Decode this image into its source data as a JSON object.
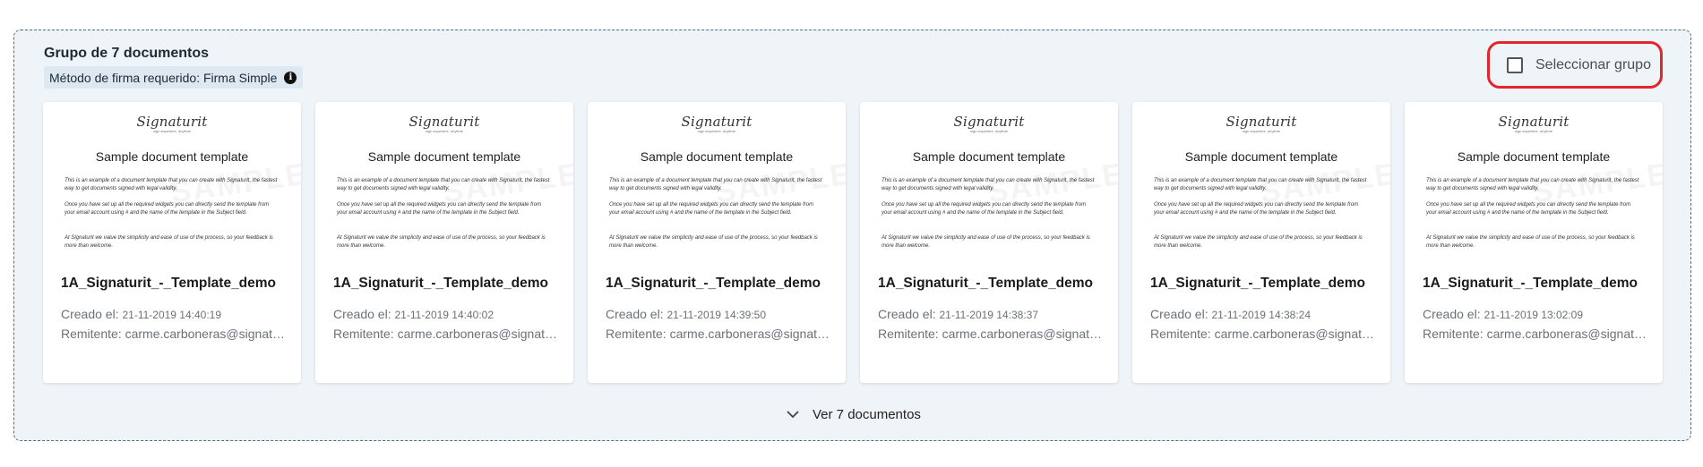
{
  "group": {
    "title": "Grupo de 7 documentos",
    "signature_method": "Método de firma requerido: Firma Simple",
    "select_label": "Seleccionar grupo",
    "see_more": "Ver 7 documentos"
  },
  "colors": {
    "group_background": "#eff4f9",
    "group_border": "#4d6e86",
    "highlight": "#e3262c"
  },
  "icons": {
    "info": "info-icon",
    "checkbox": "checkbox-unchecked-icon",
    "expand": "chevron-down-icon"
  },
  "preview": {
    "logo": "Signaturit",
    "logo_sub": "sign anywhere, anytime",
    "title": "Sample document template",
    "p1": "This is an example of a document template that you can create with Signaturit, the fastest way to get documents signed with legal validity.",
    "p2": "Once you have set up all the required widgets you can directly send the template from your email account using # and the name of the template in the Subject field.",
    "p3": "At Signaturit we value the simplicity and ease of use of the process, so your feedback is more than welcome."
  },
  "labels": {
    "created": "Creado el:",
    "sender": "Remitente:"
  },
  "cards": [
    {
      "name": "1A_Signaturit_-_Template_demo",
      "date": "21-11-2019 14:40:19",
      "sender": "carme.carboneras@signaturit.com"
    },
    {
      "name": "1A_Signaturit_-_Template_demo",
      "date": "21-11-2019 14:40:02",
      "sender": "carme.carboneras@signaturit.com"
    },
    {
      "name": "1A_Signaturit_-_Template_demo",
      "date": "21-11-2019 14:39:50",
      "sender": "carme.carboneras@signaturit.com"
    },
    {
      "name": "1A_Signaturit_-_Template_demo",
      "date": "21-11-2019 14:38:37",
      "sender": "carme.carboneras@signaturit.com"
    },
    {
      "name": "1A_Signaturit_-_Template_demo",
      "date": "21-11-2019 14:38:24",
      "sender": "carme.carboneras@signaturit.com"
    },
    {
      "name": "1A_Signaturit_-_Template_demo",
      "date": "21-11-2019 13:02:09",
      "sender": "carme.carboneras@signaturit.com"
    }
  ]
}
